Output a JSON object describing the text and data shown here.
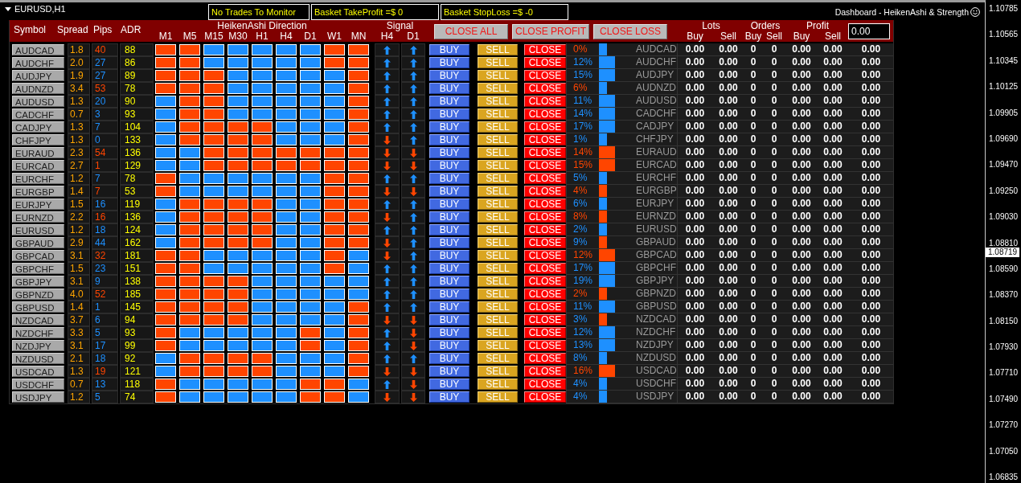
{
  "chart": {
    "title": "EURUSD,H1",
    "caption": "Dashboard - HeikenAshi & Strength"
  },
  "status_panels": [
    "No Trades To Monitor",
    "Basket TakeProfit =$ 0",
    "Basket StopLoss =$ -0"
  ],
  "header": {
    "columns": [
      "Symbol",
      "Spread",
      "Pips",
      "ADR"
    ],
    "direction_title": "HeikenAshi Direction",
    "timeframes": [
      "M1",
      "M5",
      "M15",
      "M30",
      "H1",
      "H4",
      "D1",
      "W1",
      "MN"
    ],
    "signal_title": "Signal",
    "signal_timeframes": [
      "H4",
      "D1"
    ],
    "buttons": [
      "CLOSE ALL",
      "CLOSE PROFIT",
      "CLOSE LOSS"
    ],
    "groups": [
      {
        "title": "Lots",
        "columns": [
          "Buy",
          "Sell"
        ]
      },
      {
        "title": "Orders",
        "columns": [
          "Buy",
          "Sell"
        ]
      },
      {
        "title": "Profit",
        "columns": [
          "Buy",
          "Sell"
        ]
      }
    ],
    "input_value": "0.00"
  },
  "rows": [
    {
      "symbol": "AUDCAD",
      "spread": "1.8",
      "pips": "40",
      "pips_up": false,
      "adr": "88",
      "heiken_up": [
        false,
        false,
        true,
        true,
        true,
        true,
        true,
        false,
        false
      ],
      "signal_up": [
        true,
        true
      ],
      "actions": [
        "BUY",
        "SELL",
        "CLOSE"
      ],
      "strength": "0%",
      "strength_up": false,
      "bar_up": true,
      "level": 0.25,
      "pair": "AUDCAD",
      "values": [
        "0.00",
        "0.00",
        "0",
        "0",
        "0.00",
        "0.00",
        "0.00"
      ]
    },
    {
      "symbol": "AUDCHF",
      "spread": "2.0",
      "pips": "27",
      "pips_up": true,
      "adr": "86",
      "heiken_up": [
        false,
        false,
        true,
        true,
        true,
        true,
        true,
        false,
        false
      ],
      "signal_up": [
        true,
        true
      ],
      "actions": [
        "BUY",
        "SELL",
        "CLOSE"
      ],
      "strength": "12%",
      "strength_up": true,
      "bar_up": true,
      "level": 0.5,
      "pair": "AUDCHF",
      "values": [
        "0.00",
        "0.00",
        "0",
        "0",
        "0.00",
        "0.00",
        "0.00"
      ]
    },
    {
      "symbol": "AUDJPY",
      "spread": "1.9",
      "pips": "27",
      "pips_up": true,
      "adr": "89",
      "heiken_up": [
        false,
        false,
        false,
        true,
        true,
        true,
        true,
        true,
        false
      ],
      "signal_up": [
        true,
        true
      ],
      "actions": [
        "BUY",
        "SELL",
        "CLOSE"
      ],
      "strength": "15%",
      "strength_up": true,
      "bar_up": true,
      "level": 0.5,
      "pair": "AUDJPY",
      "values": [
        "0.00",
        "0.00",
        "0",
        "0",
        "0.00",
        "0.00",
        "0.00"
      ]
    },
    {
      "symbol": "AUDNZD",
      "spread": "3.4",
      "pips": "53",
      "pips_up": false,
      "adr": "78",
      "heiken_up": [
        false,
        false,
        false,
        true,
        true,
        true,
        true,
        true,
        false
      ],
      "signal_up": [
        true,
        true
      ],
      "actions": [
        "BUY",
        "SELL",
        "CLOSE"
      ],
      "strength": "6%",
      "strength_up": false,
      "bar_up": true,
      "level": 0.25,
      "pair": "AUDNZD",
      "values": [
        "0.00",
        "0.00",
        "0",
        "0",
        "0.00",
        "0.00",
        "0.00"
      ]
    },
    {
      "symbol": "AUDUSD",
      "spread": "1.3",
      "pips": "20",
      "pips_up": true,
      "adr": "90",
      "heiken_up": [
        true,
        false,
        false,
        true,
        true,
        true,
        true,
        true,
        false
      ],
      "signal_up": [
        true,
        true
      ],
      "actions": [
        "BUY",
        "SELL",
        "CLOSE"
      ],
      "strength": "11%",
      "strength_up": true,
      "bar_up": true,
      "level": 0.5,
      "pair": "AUDUSD",
      "values": [
        "0.00",
        "0.00",
        "0",
        "0",
        "0.00",
        "0.00",
        "0.00"
      ]
    },
    {
      "symbol": "CADCHF",
      "spread": "0.7",
      "pips": "3",
      "pips_up": true,
      "adr": "93",
      "heiken_up": [
        true,
        false,
        false,
        true,
        true,
        true,
        true,
        true,
        false
      ],
      "signal_up": [
        true,
        true
      ],
      "actions": [
        "BUY",
        "SELL",
        "CLOSE"
      ],
      "strength": "14%",
      "strength_up": true,
      "bar_up": true,
      "level": 0.5,
      "pair": "CADCHF",
      "values": [
        "0.00",
        "0.00",
        "0",
        "0",
        "0.00",
        "0.00",
        "0.00"
      ]
    },
    {
      "symbol": "CADJPY",
      "spread": "1.3",
      "pips": "7",
      "pips_up": true,
      "adr": "104",
      "heiken_up": [
        true,
        false,
        false,
        false,
        false,
        true,
        true,
        true,
        false
      ],
      "signal_up": [
        true,
        true
      ],
      "actions": [
        "BUY",
        "SELL",
        "CLOSE"
      ],
      "strength": "17%",
      "strength_up": true,
      "bar_up": true,
      "level": 0.5,
      "pair": "CADJPY",
      "values": [
        "0.00",
        "0.00",
        "0",
        "0",
        "0.00",
        "0.00",
        "0.00"
      ]
    },
    {
      "symbol": "CHFJPY",
      "spread": "1.3",
      "pips": "0",
      "pips_up": true,
      "adr": "133",
      "heiken_up": [
        true,
        false,
        false,
        false,
        false,
        true,
        true,
        true,
        false
      ],
      "signal_up": [
        false,
        true
      ],
      "actions": [
        "BUY",
        "SELL",
        "CLOSE"
      ],
      "strength": "1%",
      "strength_up": true,
      "bar_up": true,
      "level": 0.25,
      "pair": "CHFJPY",
      "values": [
        "0.00",
        "0.00",
        "0",
        "0",
        "0.00",
        "0.00",
        "0.00"
      ]
    },
    {
      "symbol": "EURAUD",
      "spread": "2.3",
      "pips": "54",
      "pips_up": false,
      "adr": "136",
      "heiken_up": [
        true,
        true,
        false,
        false,
        false,
        false,
        false,
        false,
        false
      ],
      "signal_up": [
        false,
        false
      ],
      "actions": [
        "BUY",
        "SELL",
        "CLOSE"
      ],
      "strength": "14%",
      "strength_up": false,
      "bar_up": false,
      "level": 0.5,
      "pair": "EURAUD",
      "values": [
        "0.00",
        "0.00",
        "0",
        "0",
        "0.00",
        "0.00",
        "0.00"
      ]
    },
    {
      "symbol": "EURCAD",
      "spread": "2.7",
      "pips": "1",
      "pips_up": false,
      "adr": "129",
      "heiken_up": [
        true,
        true,
        false,
        false,
        false,
        false,
        false,
        false,
        false
      ],
      "signal_up": [
        false,
        false
      ],
      "actions": [
        "BUY",
        "SELL",
        "CLOSE"
      ],
      "strength": "15%",
      "strength_up": false,
      "bar_up": false,
      "level": 0.5,
      "pair": "EURCAD",
      "values": [
        "0.00",
        "0.00",
        "0",
        "0",
        "0.00",
        "0.00",
        "0.00"
      ]
    },
    {
      "symbol": "EURCHF",
      "spread": "1.2",
      "pips": "7",
      "pips_up": true,
      "adr": "78",
      "heiken_up": [
        false,
        true,
        true,
        true,
        true,
        true,
        true,
        false,
        false
      ],
      "signal_up": [
        true,
        true
      ],
      "actions": [
        "BUY",
        "SELL",
        "CLOSE"
      ],
      "strength": "5%",
      "strength_up": true,
      "bar_up": true,
      "level": 0.25,
      "pair": "EURCHF",
      "values": [
        "0.00",
        "0.00",
        "0",
        "0",
        "0.00",
        "0.00",
        "0.00"
      ]
    },
    {
      "symbol": "EURGBP",
      "spread": "1.4",
      "pips": "7",
      "pips_up": false,
      "adr": "53",
      "heiken_up": [
        false,
        true,
        true,
        true,
        true,
        true,
        true,
        false,
        false
      ],
      "signal_up": [
        false,
        false
      ],
      "actions": [
        "BUY",
        "SELL",
        "CLOSE"
      ],
      "strength": "4%",
      "strength_up": false,
      "bar_up": false,
      "level": 0.25,
      "pair": "EURGBP",
      "values": [
        "0.00",
        "0.00",
        "0",
        "0",
        "0.00",
        "0.00",
        "0.00"
      ]
    },
    {
      "symbol": "EURJPY",
      "spread": "1.5",
      "pips": "16",
      "pips_up": true,
      "adr": "119",
      "heiken_up": [
        true,
        false,
        false,
        false,
        false,
        true,
        true,
        false,
        false
      ],
      "signal_up": [
        true,
        true
      ],
      "actions": [
        "BUY",
        "SELL",
        "CLOSE"
      ],
      "strength": "6%",
      "strength_up": true,
      "bar_up": true,
      "level": 0.25,
      "pair": "EURJPY",
      "values": [
        "0.00",
        "0.00",
        "0",
        "0",
        "0.00",
        "0.00",
        "0.00"
      ]
    },
    {
      "symbol": "EURNZD",
      "spread": "2.2",
      "pips": "16",
      "pips_up": false,
      "adr": "136",
      "heiken_up": [
        true,
        false,
        false,
        false,
        false,
        true,
        true,
        false,
        false
      ],
      "signal_up": [
        false,
        true
      ],
      "actions": [
        "BUY",
        "SELL",
        "CLOSE"
      ],
      "strength": "8%",
      "strength_up": false,
      "bar_up": false,
      "level": 0.25,
      "pair": "EURNZD",
      "values": [
        "0.00",
        "0.00",
        "0",
        "0",
        "0.00",
        "0.00",
        "0.00"
      ]
    },
    {
      "symbol": "EURUSD",
      "spread": "1.2",
      "pips": "18",
      "pips_up": true,
      "adr": "124",
      "heiken_up": [
        true,
        false,
        false,
        false,
        false,
        true,
        true,
        false,
        false
      ],
      "signal_up": [
        true,
        true
      ],
      "actions": [
        "BUY",
        "SELL",
        "CLOSE"
      ],
      "strength": "2%",
      "strength_up": true,
      "bar_up": true,
      "level": 0.25,
      "pair": "EURUSD",
      "values": [
        "0.00",
        "0.00",
        "0",
        "0",
        "0.00",
        "0.00",
        "0.00"
      ]
    },
    {
      "symbol": "GBPAUD",
      "spread": "2.9",
      "pips": "44",
      "pips_up": true,
      "adr": "162",
      "heiken_up": [
        true,
        false,
        false,
        false,
        false,
        true,
        true,
        false,
        false
      ],
      "signal_up": [
        false,
        true
      ],
      "actions": [
        "BUY",
        "SELL",
        "CLOSE"
      ],
      "strength": "9%",
      "strength_up": true,
      "bar_up": false,
      "level": 0.25,
      "pair": "GBPAUD",
      "values": [
        "0.00",
        "0.00",
        "0",
        "0",
        "0.00",
        "0.00",
        "0.00"
      ]
    },
    {
      "symbol": "GBPCAD",
      "spread": "3.1",
      "pips": "32",
      "pips_up": false,
      "adr": "181",
      "heiken_up": [
        false,
        false,
        true,
        true,
        true,
        true,
        true,
        false,
        true
      ],
      "signal_up": [
        false,
        true
      ],
      "actions": [
        "BUY",
        "SELL",
        "CLOSE"
      ],
      "strength": "12%",
      "strength_up": false,
      "bar_up": false,
      "level": 0.5,
      "pair": "GBPCAD",
      "values": [
        "0.00",
        "0.00",
        "0",
        "0",
        "0.00",
        "0.00",
        "0.00"
      ]
    },
    {
      "symbol": "GBPCHF",
      "spread": "1.5",
      "pips": "23",
      "pips_up": true,
      "adr": "151",
      "heiken_up": [
        false,
        false,
        true,
        true,
        true,
        true,
        true,
        false,
        true
      ],
      "signal_up": [
        true,
        true
      ],
      "actions": [
        "BUY",
        "SELL",
        "CLOSE"
      ],
      "strength": "17%",
      "strength_up": true,
      "bar_up": true,
      "level": 0.5,
      "pair": "GBPCHF",
      "values": [
        "0.00",
        "0.00",
        "0",
        "0",
        "0.00",
        "0.00",
        "0.00"
      ]
    },
    {
      "symbol": "GBPJPY",
      "spread": "3.1",
      "pips": "9",
      "pips_up": true,
      "adr": "138",
      "heiken_up": [
        false,
        false,
        false,
        false,
        true,
        true,
        true,
        true,
        true
      ],
      "signal_up": [
        true,
        true
      ],
      "actions": [
        "BUY",
        "SELL",
        "CLOSE"
      ],
      "strength": "19%",
      "strength_up": true,
      "bar_up": true,
      "level": 0.5,
      "pair": "GBPJPY",
      "values": [
        "0.00",
        "0.00",
        "0",
        "0",
        "0.00",
        "0.00",
        "0.00"
      ]
    },
    {
      "symbol": "GBPNZD",
      "spread": "4.0",
      "pips": "52",
      "pips_up": false,
      "adr": "185",
      "heiken_up": [
        false,
        false,
        false,
        false,
        true,
        true,
        true,
        true,
        true
      ],
      "signal_up": [
        true,
        true
      ],
      "actions": [
        "BUY",
        "SELL",
        "CLOSE"
      ],
      "strength": "2%",
      "strength_up": false,
      "bar_up": false,
      "level": 0.25,
      "pair": "GBPNZD",
      "values": [
        "0.00",
        "0.00",
        "0",
        "0",
        "0.00",
        "0.00",
        "0.00"
      ]
    },
    {
      "symbol": "GBPUSD",
      "spread": "1.4",
      "pips": "1",
      "pips_up": true,
      "adr": "145",
      "heiken_up": [
        false,
        false,
        false,
        false,
        true,
        true,
        true,
        true,
        false
      ],
      "signal_up": [
        true,
        true
      ],
      "actions": [
        "BUY",
        "SELL",
        "CLOSE"
      ],
      "strength": "11%",
      "strength_up": true,
      "bar_up": true,
      "level": 0.5,
      "pair": "GBPUSD",
      "values": [
        "0.00",
        "0.00",
        "0",
        "0",
        "0.00",
        "0.00",
        "0.00"
      ]
    },
    {
      "symbol": "NZDCAD",
      "spread": "3.7",
      "pips": "6",
      "pips_up": true,
      "adr": "94",
      "heiken_up": [
        false,
        false,
        false,
        false,
        true,
        true,
        true,
        true,
        false
      ],
      "signal_up": [
        false,
        false
      ],
      "actions": [
        "BUY",
        "SELL",
        "CLOSE"
      ],
      "strength": "3%",
      "strength_up": true,
      "bar_up": false,
      "level": 0.25,
      "pair": "NZDCAD",
      "values": [
        "0.00",
        "0.00",
        "0",
        "0",
        "0.00",
        "0.00",
        "0.00"
      ]
    },
    {
      "symbol": "NZDCHF",
      "spread": "3.3",
      "pips": "5",
      "pips_up": true,
      "adr": "93",
      "heiken_up": [
        false,
        true,
        true,
        true,
        true,
        true,
        false,
        true,
        false
      ],
      "signal_up": [
        true,
        false
      ],
      "actions": [
        "BUY",
        "SELL",
        "CLOSE"
      ],
      "strength": "12%",
      "strength_up": true,
      "bar_up": true,
      "level": 0.5,
      "pair": "NZDCHF",
      "values": [
        "0.00",
        "0.00",
        "0",
        "0",
        "0.00",
        "0.00",
        "0.00"
      ]
    },
    {
      "symbol": "NZDJPY",
      "spread": "3.1",
      "pips": "17",
      "pips_up": true,
      "adr": "99",
      "heiken_up": [
        false,
        true,
        true,
        true,
        true,
        true,
        false,
        true,
        false
      ],
      "signal_up": [
        true,
        false
      ],
      "actions": [
        "BUY",
        "SELL",
        "CLOSE"
      ],
      "strength": "13%",
      "strength_up": true,
      "bar_up": true,
      "level": 0.5,
      "pair": "NZDJPY",
      "values": [
        "0.00",
        "0.00",
        "0",
        "0",
        "0.00",
        "0.00",
        "0.00"
      ]
    },
    {
      "symbol": "NZDUSD",
      "spread": "2.1",
      "pips": "18",
      "pips_up": true,
      "adr": "92",
      "heiken_up": [
        true,
        false,
        false,
        false,
        false,
        true,
        true,
        true,
        false
      ],
      "signal_up": [
        true,
        true
      ],
      "actions": [
        "BUY",
        "SELL",
        "CLOSE"
      ],
      "strength": "8%",
      "strength_up": true,
      "bar_up": true,
      "level": 0.25,
      "pair": "NZDUSD",
      "values": [
        "0.00",
        "0.00",
        "0",
        "0",
        "0.00",
        "0.00",
        "0.00"
      ]
    },
    {
      "symbol": "USDCAD",
      "spread": "1.3",
      "pips": "19",
      "pips_up": false,
      "adr": "121",
      "heiken_up": [
        true,
        false,
        false,
        false,
        false,
        true,
        true,
        true,
        false
      ],
      "signal_up": [
        false,
        false
      ],
      "actions": [
        "BUY",
        "SELL",
        "CLOSE"
      ],
      "strength": "16%",
      "strength_up": false,
      "bar_up": false,
      "level": 0.5,
      "pair": "USDCAD",
      "values": [
        "0.00",
        "0.00",
        "0",
        "0",
        "0.00",
        "0.00",
        "0.00"
      ]
    },
    {
      "symbol": "USDCHF",
      "spread": "0.7",
      "pips": "13",
      "pips_up": true,
      "adr": "118",
      "heiken_up": [
        false,
        true,
        true,
        true,
        true,
        true,
        false,
        false,
        true
      ],
      "signal_up": [
        true,
        false
      ],
      "actions": [
        "BUY",
        "SELL",
        "CLOSE"
      ],
      "strength": "4%",
      "strength_up": true,
      "bar_up": true,
      "level": 0.25,
      "pair": "USDCHF",
      "values": [
        "0.00",
        "0.00",
        "0",
        "0",
        "0.00",
        "0.00",
        "0.00"
      ]
    },
    {
      "symbol": "USDJPY",
      "spread": "1.2",
      "pips": "5",
      "pips_up": true,
      "adr": "74",
      "heiken_up": [
        false,
        true,
        true,
        true,
        true,
        true,
        false,
        false,
        true
      ],
      "signal_up": [
        false,
        false
      ],
      "actions": [
        "BUY",
        "SELL",
        "CLOSE"
      ],
      "strength": "4%",
      "strength_up": true,
      "bar_up": true,
      "level": 0.25,
      "pair": "USDJPY",
      "values": [
        "0.00",
        "0.00",
        "0",
        "0",
        "0.00",
        "0.00",
        "0.00"
      ]
    }
  ],
  "price_axis": [
    {
      "kind": "tick",
      "label": "1.10785"
    },
    {
      "kind": "tick",
      "label": "1.10565"
    },
    {
      "kind": "tick",
      "label": "1.10345"
    },
    {
      "kind": "tick",
      "label": "1.10125"
    },
    {
      "kind": "tick",
      "label": "1.09905"
    },
    {
      "kind": "tick",
      "label": "1.09690"
    },
    {
      "kind": "tick",
      "label": "1.09470"
    },
    {
      "kind": "tick",
      "label": "1.09250"
    },
    {
      "kind": "tick",
      "label": "1.09030"
    },
    {
      "kind": "tick",
      "label": "1.08810"
    },
    {
      "kind": "current",
      "label": "1.08719"
    },
    {
      "kind": "tick",
      "label": "1.08590"
    },
    {
      "kind": "tick",
      "label": "1.08370"
    },
    {
      "kind": "tick",
      "label": "1.08150"
    },
    {
      "kind": "tick",
      "label": "1.07930"
    },
    {
      "kind": "tick",
      "label": "1.07710"
    },
    {
      "kind": "tick",
      "label": "1.07490"
    },
    {
      "kind": "tick",
      "label": "1.07270"
    },
    {
      "kind": "tick",
      "label": "1.07050"
    },
    {
      "kind": "tick",
      "label": "1.06835"
    }
  ]
}
